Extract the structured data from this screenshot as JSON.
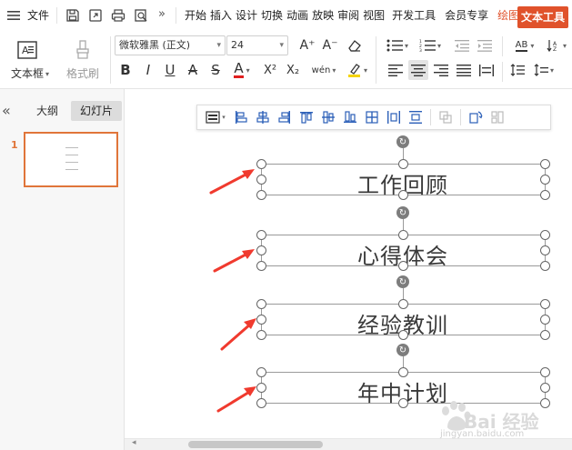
{
  "menubar": {
    "file_label": "文件",
    "items": [
      {
        "label": "开始"
      },
      {
        "label": "插入"
      },
      {
        "label": "设计"
      },
      {
        "label": "切换"
      },
      {
        "label": "动画"
      },
      {
        "label": "放映"
      },
      {
        "label": "审阅"
      },
      {
        "label": "视图"
      },
      {
        "label": "开发工具"
      },
      {
        "label": "会员专享"
      },
      {
        "label": "绘图工具"
      },
      {
        "label": "文本工具"
      }
    ],
    "accent_color": "#e0522b"
  },
  "ribbon": {
    "textbox_label": "文本框",
    "format_painter_label": "格式刷",
    "font_name": "微软雅黑 (正文)",
    "font_size": "24",
    "bold": "B",
    "italic": "I",
    "underline": "U",
    "strike_a": "A",
    "strike_s": "S",
    "font_color": "A",
    "superscript": "X²",
    "subscript": "X₂",
    "pinyin": "wén",
    "increase_font": "A⁺",
    "decrease_font": "A⁻",
    "ab_label": "AB"
  },
  "leftpanel": {
    "tab_outline": "大纲",
    "tab_slides": "幻灯片",
    "slide_number": "1",
    "collapse_glyph": "«"
  },
  "slide": {
    "textboxes": [
      {
        "text": "工作回顾"
      },
      {
        "text": "心得体会"
      },
      {
        "text": "经验教训"
      },
      {
        "text": "年中计划"
      }
    ]
  },
  "watermark": {
    "text": "Bai 经验",
    "url": "jingyan.baidu.com"
  },
  "colors": {
    "selection_border": "#e0753a",
    "arrow": "#f03a2e",
    "align_icon": "#2b5fb8"
  }
}
